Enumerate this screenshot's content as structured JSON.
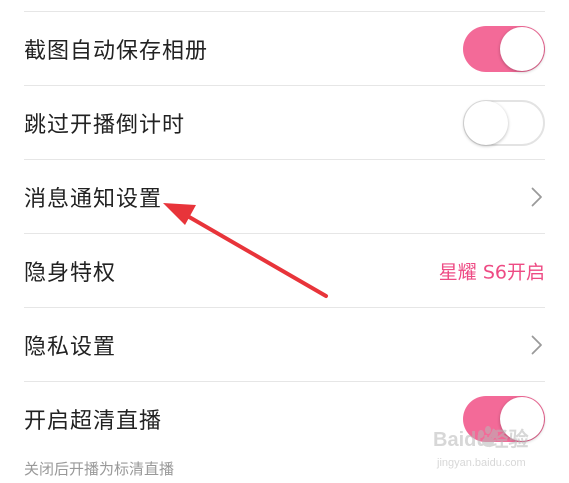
{
  "settings": {
    "rows": [
      {
        "label": "截图自动保存相册",
        "control": "toggle",
        "state": "on"
      },
      {
        "label": "跳过开播倒计时",
        "control": "toggle",
        "state": "off"
      },
      {
        "label": "消息通知设置",
        "control": "chevron"
      },
      {
        "label": "隐身特权",
        "control": "value",
        "value": "星耀 S6开启"
      },
      {
        "label": "隐私设置",
        "control": "chevron"
      },
      {
        "label": "开启超清直播",
        "control": "toggle",
        "state": "on"
      }
    ],
    "hint": "关闭后开播为标清直播"
  },
  "colors": {
    "accent": "#f36a98",
    "value_text": "#ee4b84",
    "annotation_arrow": "#e8343a",
    "divider": "#e6e6e6"
  },
  "icons": {
    "chevron": "chevron-right-icon",
    "annotation": "red-arrow-annotation"
  },
  "watermark": {
    "brand": "Baidu经验",
    "url": "jingyan.baidu.com"
  }
}
